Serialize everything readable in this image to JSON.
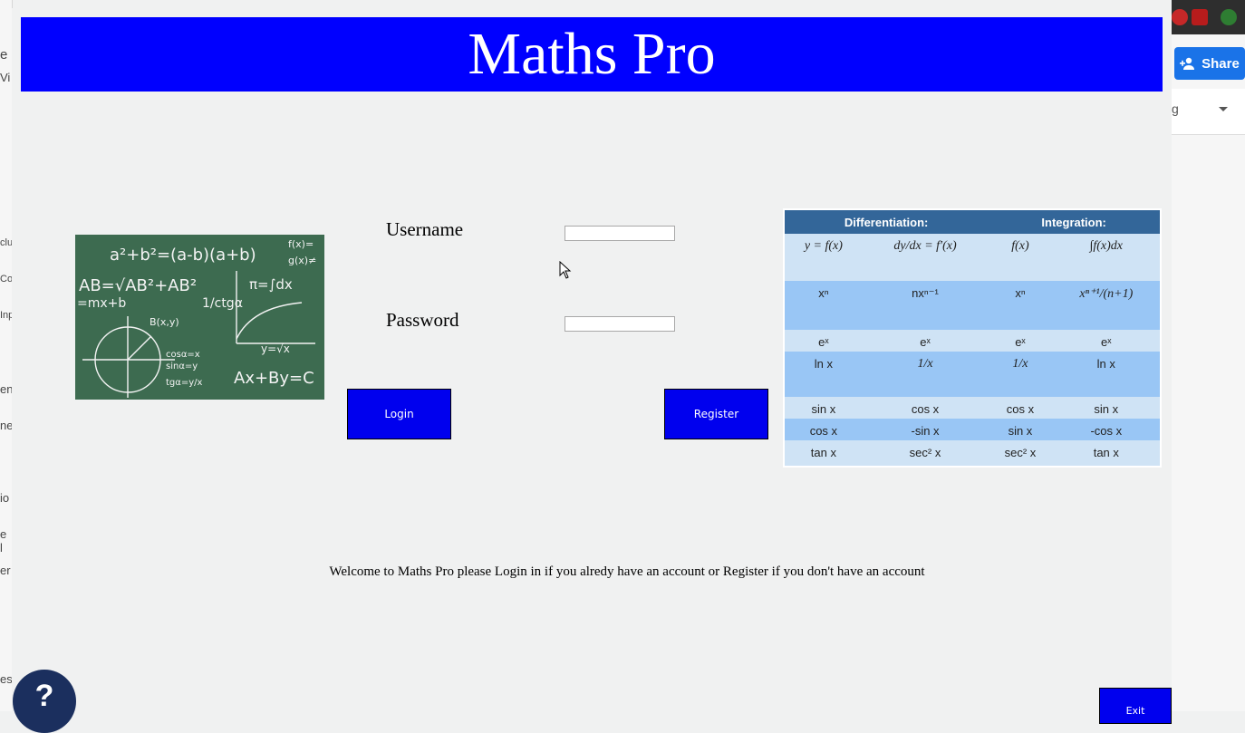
{
  "app": {
    "title": "Maths Pro",
    "username_label": "Username",
    "password_label": "Password",
    "username_value": "",
    "password_value": "",
    "login_label": "Login",
    "register_label": "Register",
    "exit_label": "Exit",
    "help_label": "?",
    "welcome_text": "Welcome to Maths Pro please Login in if you alredy have an account or Register if you don't have an account",
    "formula_sheet": {
      "headers": [
        "Differentiation:",
        "Integration:"
      ],
      "rows": [
        [
          "y = f(x)",
          "dy/dx = f′(x)",
          "f(x)",
          "∫f(x)dx"
        ],
        [
          "xⁿ",
          "nxⁿ⁻¹",
          "xⁿ",
          "xⁿ⁺¹/(n+1)"
        ],
        [
          "eˣ",
          "eˣ",
          "eˣ",
          "eˣ"
        ],
        [
          "ln x",
          "1/x",
          "1/x",
          "ln x"
        ],
        [
          "sin x",
          "cos x",
          "cos x",
          "sin x"
        ],
        [
          "cos x",
          "-sin x",
          "sin x",
          "-cos x"
        ],
        [
          "tan x",
          "sec² x",
          "sec² x",
          "tan x"
        ]
      ]
    }
  },
  "browser": {
    "share_label": "Share",
    "left_fragments": [
      "e",
      "Vi",
      "clu",
      "Co",
      "Inp",
      "ent",
      "ne",
      "io",
      "e l",
      "er",
      "es"
    ],
    "toolbar_fragment": "g"
  },
  "colors": {
    "header": "#0000ff",
    "buttons": "#0000ee",
    "table_header": "#336699",
    "table_light": "#cfe3f5",
    "table_alt": "#99c6f5",
    "share": "#1a73e8"
  }
}
